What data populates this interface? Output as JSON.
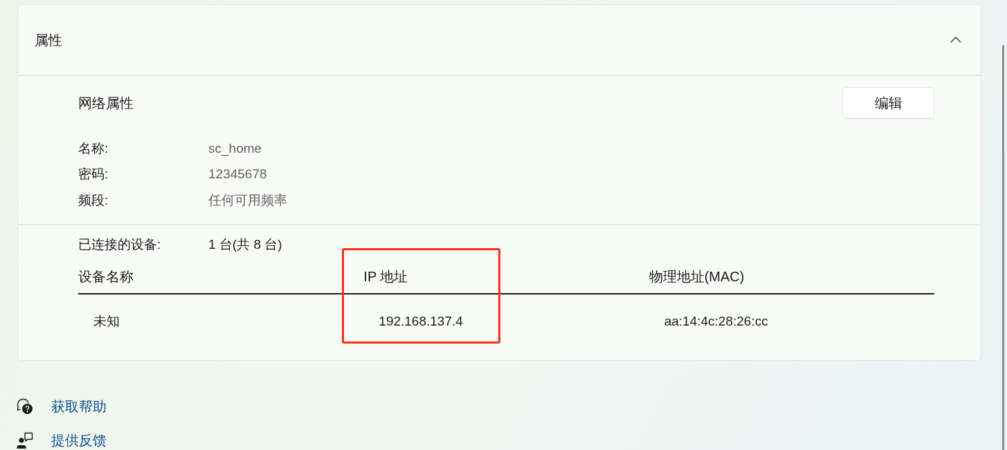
{
  "section": {
    "title": "属性",
    "expanded": true
  },
  "network_properties": {
    "title": "网络属性",
    "edit_button": "编辑",
    "fields": [
      {
        "label": "名称:",
        "value": "sc_home"
      },
      {
        "label": "密码:",
        "value": "12345678"
      },
      {
        "label": "频段:",
        "value": "任何可用频率"
      }
    ]
  },
  "connected_devices": {
    "label": "已连接的设备:",
    "value": "1 台(共 8 台)",
    "table": {
      "columns": [
        {
          "label": "设备名称",
          "highlighted": false
        },
        {
          "label": "IP 地址",
          "highlighted": true
        },
        {
          "label": "物理地址(MAC)",
          "highlighted": false
        }
      ],
      "rows": [
        [
          "未知",
          "192.168.137.4",
          "aa:14:4c:28:26:cc"
        ]
      ]
    }
  },
  "links": [
    {
      "kind": "help",
      "label": "获取帮助"
    },
    {
      "kind": "feedback",
      "label": "提供反馈"
    }
  ]
}
